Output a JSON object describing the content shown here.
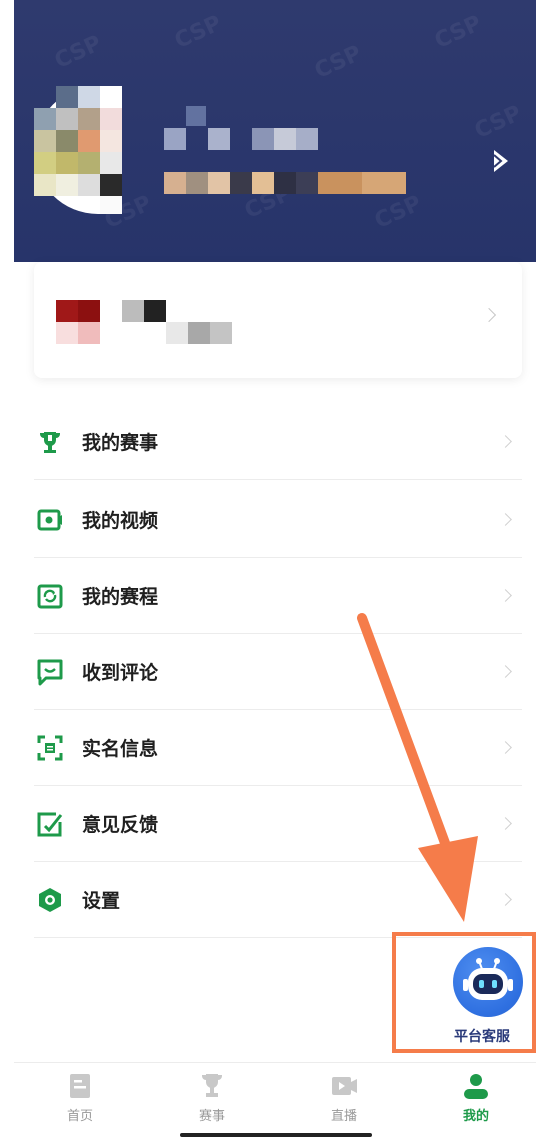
{
  "menu": {
    "items": [
      {
        "label": "我的赛事",
        "icon": "trophy-icon"
      },
      {
        "label": "我的视频",
        "icon": "video-icon"
      },
      {
        "label": "我的赛程",
        "icon": "schedule-icon"
      },
      {
        "label": "收到评论",
        "icon": "comment-icon"
      },
      {
        "label": "实名信息",
        "icon": "id-card-icon"
      },
      {
        "label": "意见反馈",
        "icon": "feedback-icon"
      },
      {
        "label": "设置",
        "icon": "settings-icon"
      }
    ]
  },
  "customer_service": {
    "label": "平台客服",
    "icon": "robot-icon"
  },
  "tabbar": {
    "tabs": [
      {
        "label": "首页",
        "icon": "home-icon",
        "active": false
      },
      {
        "label": "赛事",
        "icon": "trophy-icon",
        "active": false
      },
      {
        "label": "直播",
        "icon": "live-video-icon",
        "active": false
      },
      {
        "label": "我的",
        "icon": "user-icon",
        "active": true
      }
    ]
  },
  "colors": {
    "accent": "#1e9a4a",
    "header_bg": "#2f3a6e",
    "annotation": "#f57c4a",
    "cs_blue": "#2e6fe0"
  }
}
